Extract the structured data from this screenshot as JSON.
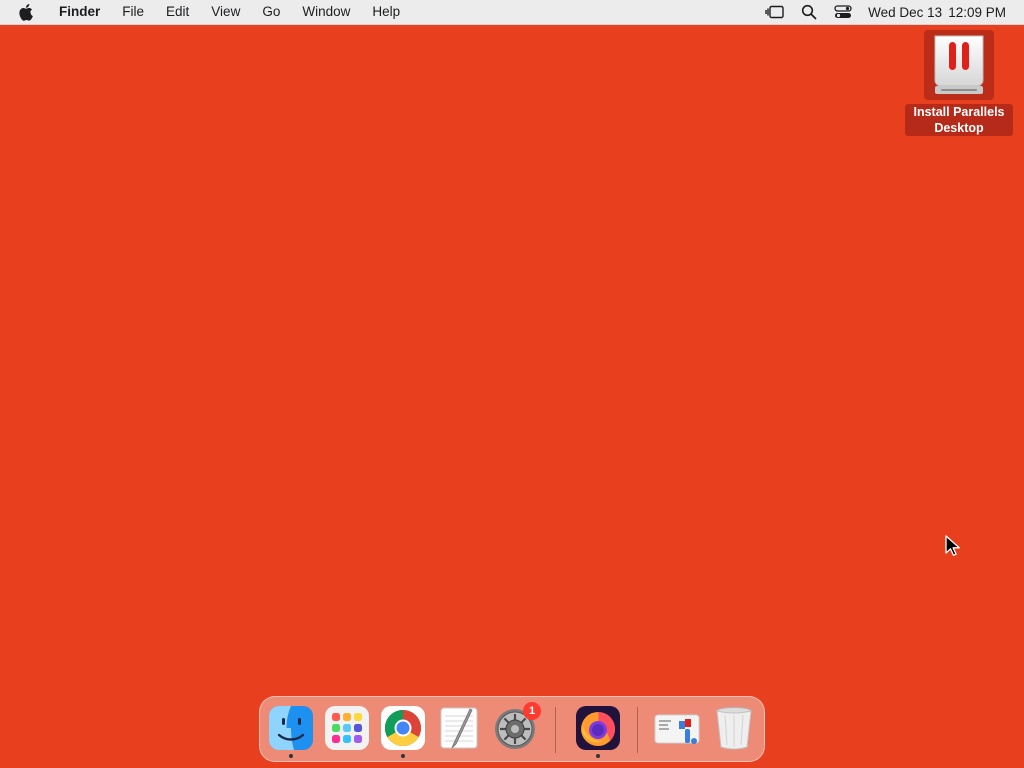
{
  "menubar": {
    "app_name": "Finder",
    "menus": [
      "File",
      "Edit",
      "View",
      "Go",
      "Window",
      "Help"
    ],
    "clock": {
      "date": "Wed Dec 13",
      "time": "12:09 PM"
    }
  },
  "desktop": {
    "background_color": "#e8401f",
    "icons": [
      {
        "label": "Install Parallels Desktop",
        "icon": "parallels-installer-icon"
      }
    ]
  },
  "dock": {
    "apps": [
      {
        "name": "Finder",
        "icon": "finder-icon",
        "running": true
      },
      {
        "name": "Launchpad",
        "icon": "launchpad-icon",
        "running": false
      },
      {
        "name": "Google Chrome",
        "icon": "chrome-icon",
        "running": true
      },
      {
        "name": "TextEdit",
        "icon": "textedit-icon",
        "running": false
      },
      {
        "name": "System Settings",
        "icon": "system-settings-icon",
        "running": false,
        "badge": "1"
      },
      {
        "name": "Firefox",
        "icon": "firefox-icon",
        "running": true
      },
      {
        "name": "Downloads",
        "icon": "downloads-stack-icon",
        "running": false
      },
      {
        "name": "Trash",
        "icon": "trash-icon",
        "running": false
      }
    ]
  }
}
